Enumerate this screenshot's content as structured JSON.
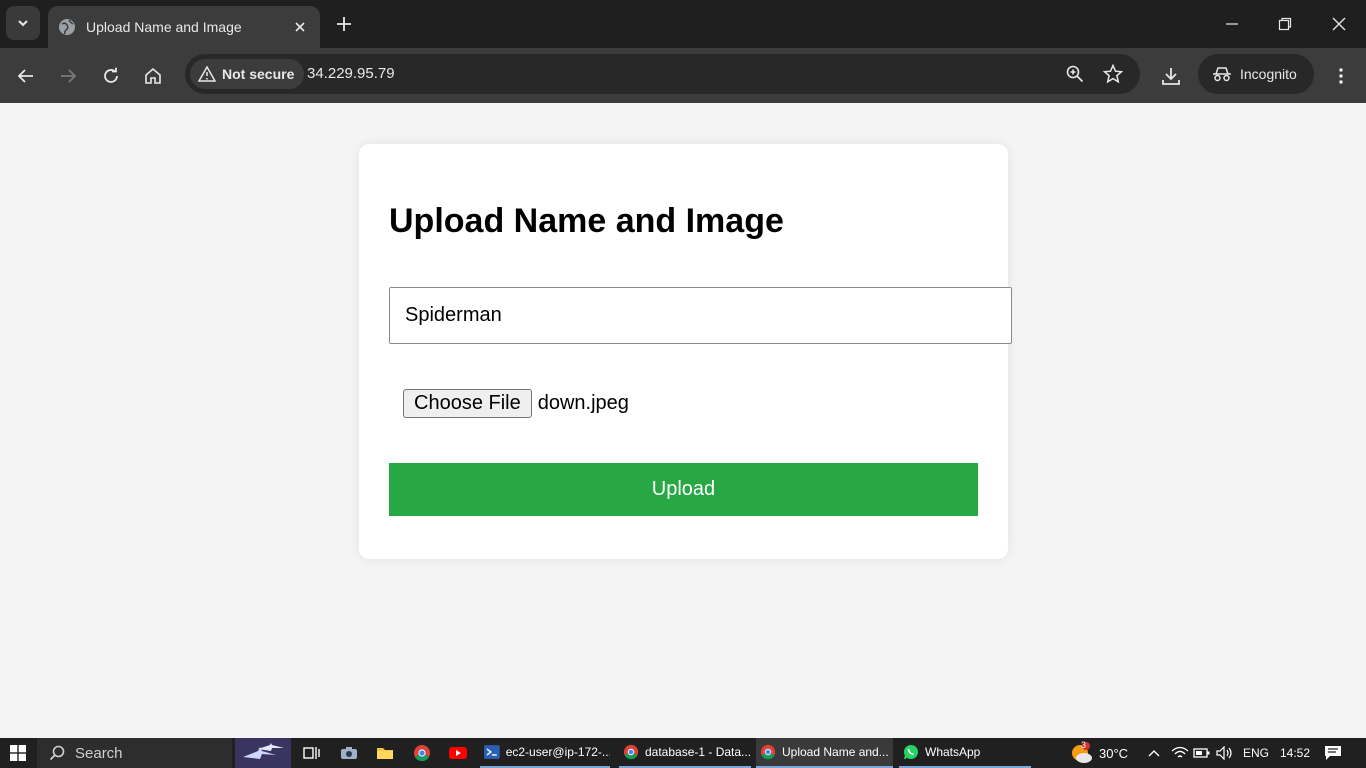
{
  "browser": {
    "tab_title": "Upload Name and Image",
    "security_label": "Not secure",
    "url": "34.229.95.79",
    "profile_label": "Incognito"
  },
  "page": {
    "heading": "Upload Name and Image",
    "name_value": "Spiderman",
    "choose_file_label": "Choose File",
    "file_name": "down.jpeg",
    "upload_label": "Upload",
    "upload_color": "#28a745"
  },
  "taskbar": {
    "search_label": "Search",
    "apps": [
      {
        "label": "ec2-user@ip-172-...",
        "icon": "terminal-icon"
      },
      {
        "label": "database-1 - Data...",
        "icon": "chrome-icon"
      },
      {
        "label": "Upload Name and...",
        "icon": "chrome-icon"
      },
      {
        "label": "WhatsApp",
        "icon": "whatsapp-icon"
      }
    ],
    "weather_badge": "3",
    "temperature": "30°C",
    "language": "ENG",
    "time": "14:52"
  }
}
